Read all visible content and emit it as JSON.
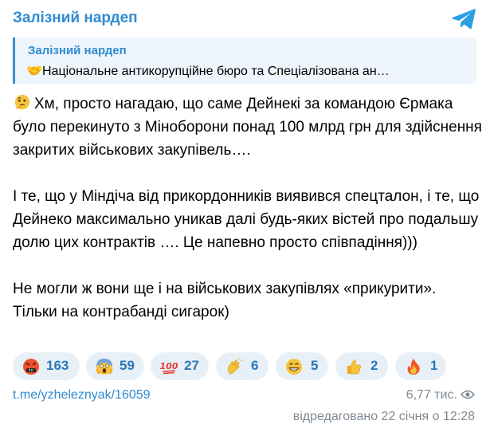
{
  "header": {
    "channel_title": "Залізний нардеп",
    "logo_icon": "telegram-plane-icon"
  },
  "reply": {
    "author": "Залізний нардеп",
    "emoji": "🤝",
    "text": "Національне антикорупційне бюро та Спеціалізована ан…"
  },
  "post": {
    "paragraph1": "Хм, просто нагадаю, що саме Дейнекі за командою Єрмака було перекинуто з Міноборони понад 100 млрд грн для здійснення закритих військових закупівель….",
    "paragraph2": "І те, що у Міндіча від прикордонників виявився спецталон, і те, що Дейнеко максимально уникав далі будь-яких вістей про подальшу долю цих контрактів …. Це напевно просто співпадіння)))",
    "paragraph3": "Не могли ж вони ще і на військових закупівлях «прикурити». Тільки на контрабанді сигарок)"
  },
  "reactions": [
    {
      "icon": "swearing-face-icon",
      "count": "163"
    },
    {
      "icon": "screaming-face-icon",
      "count": "59"
    },
    {
      "icon": "hundred-points-icon",
      "count": "27"
    },
    {
      "icon": "clapping-hands-icon",
      "count": "6"
    },
    {
      "icon": "grinning-face-icon",
      "count": "5"
    },
    {
      "icon": "thumbs-up-icon",
      "count": "2"
    },
    {
      "icon": "fire-icon",
      "count": "1"
    }
  ],
  "footer": {
    "link": "t.me/yzheleznyak/16059",
    "views": "6,77 тис.",
    "edited": "відредаговано  22 січня о 12:28"
  },
  "colors": {
    "accent": "#2f8bd0",
    "reaction_bg": "#e8f0f7",
    "reaction_text": "#2b77b8",
    "muted": "#808a94"
  }
}
